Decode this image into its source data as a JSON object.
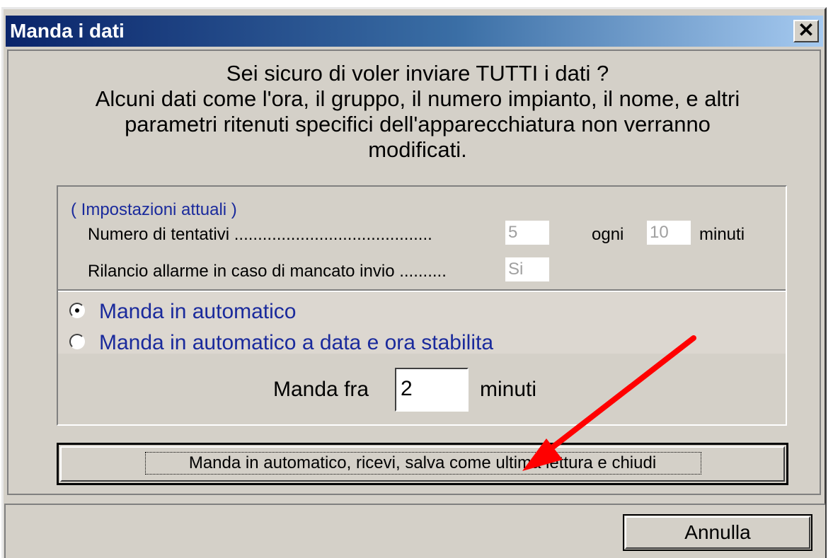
{
  "window": {
    "title": "Manda i dati",
    "close_glyph": "✕"
  },
  "message": {
    "line1": "Sei sicuro di voler inviare TUTTI i dati ?",
    "line2": "Alcuni dati come l'ora, il gruppo, il numero impianto, il nome, e altri",
    "line3": "parametri ritenuti specifici dell'apparecchiatura non verranno",
    "line4": "modificati."
  },
  "settings": {
    "title": "( Impostazioni attuali )",
    "attempts_label": "Numero di tentativi ..........................................",
    "attempts_value": "5",
    "every_label": "ogni",
    "every_value": "10",
    "minutes_label": "minuti",
    "alarm_label": "Rilancio allarme in caso di mancato invio ..........",
    "alarm_value": "Si"
  },
  "options": {
    "auto_label": "Manda in automatico",
    "scheduled_label": "Manda in automatico a data e ora stabilita",
    "selected": "auto"
  },
  "delay": {
    "label": "Manda fra",
    "value": "2",
    "unit": "minuti"
  },
  "buttons": {
    "main": "Manda in automatico, ricevi, salva come ultima lettura e chiudi",
    "cancel": "Annulla"
  },
  "colors": {
    "accent_text": "#1a2a9c",
    "annotation_arrow": "#ff0000"
  }
}
